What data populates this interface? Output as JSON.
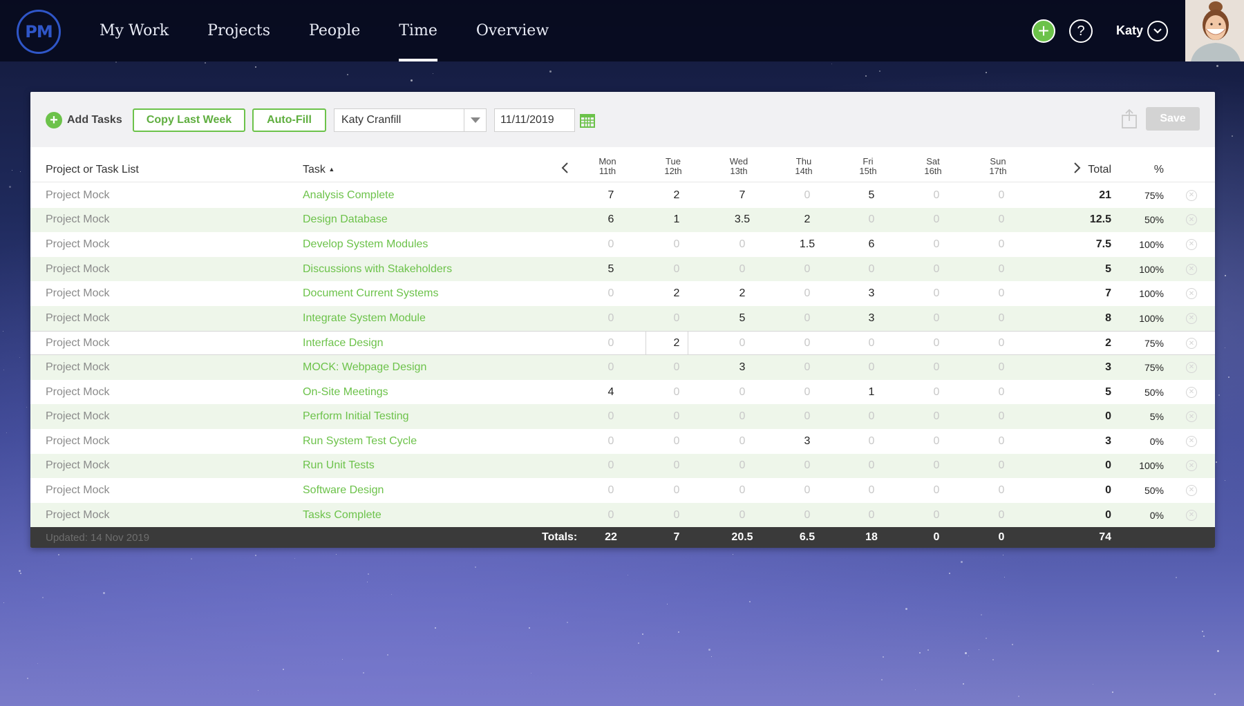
{
  "app": {
    "logo_text": "PM"
  },
  "nav": {
    "items": [
      {
        "label": "My Work"
      },
      {
        "label": "Projects"
      },
      {
        "label": "People"
      },
      {
        "label": "Time",
        "active": true
      },
      {
        "label": "Overview"
      }
    ],
    "user_name": "Katy",
    "add_icon": "plus-circle-icon",
    "help_icon": "question-circle-icon"
  },
  "toolbar": {
    "add_tasks_label": "Add Tasks",
    "copy_last_week_label": "Copy Last Week",
    "auto_fill_label": "Auto-Fill",
    "user_select_value": "Katy Cranfill",
    "date_value": "11/11/2019",
    "save_label": "Save"
  },
  "table": {
    "headers": {
      "project": "Project or Task List",
      "task": "Task",
      "task_sort": "▲",
      "total": "Total",
      "percent": "%"
    },
    "days": [
      {
        "day": "Mon",
        "date": "11th"
      },
      {
        "day": "Tue",
        "date": "12th"
      },
      {
        "day": "Wed",
        "date": "13th"
      },
      {
        "day": "Thu",
        "date": "14th"
      },
      {
        "day": "Fri",
        "date": "15th"
      },
      {
        "day": "Sat",
        "date": "16th"
      },
      {
        "day": "Sun",
        "date": "17th"
      }
    ],
    "rows": [
      {
        "project": "Project Mock",
        "task": "Analysis Complete",
        "hours": [
          "7",
          "2",
          "7",
          "0",
          "5",
          "0",
          "0"
        ],
        "total": "21",
        "pct": "75%"
      },
      {
        "project": "Project Mock",
        "task": "Design Database",
        "hours": [
          "6",
          "1",
          "3.5",
          "2",
          "0",
          "0",
          "0"
        ],
        "total": "12.5",
        "pct": "50%"
      },
      {
        "project": "Project Mock",
        "task": "Develop System Modules",
        "hours": [
          "0",
          "0",
          "0",
          "1.5",
          "6",
          "0",
          "0"
        ],
        "total": "7.5",
        "pct": "100%"
      },
      {
        "project": "Project Mock",
        "task": "Discussions with Stakeholders",
        "hours": [
          "5",
          "0",
          "0",
          "0",
          "0",
          "0",
          "0"
        ],
        "total": "5",
        "pct": "100%"
      },
      {
        "project": "Project Mock",
        "task": "Document Current Systems",
        "hours": [
          "0",
          "2",
          "2",
          "0",
          "3",
          "0",
          "0"
        ],
        "total": "7",
        "pct": "100%"
      },
      {
        "project": "Project Mock",
        "task": "Integrate System Module",
        "hours": [
          "0",
          "0",
          "5",
          "0",
          "3",
          "0",
          "0"
        ],
        "total": "8",
        "pct": "100%"
      },
      {
        "project": "Project Mock",
        "task": "Interface Design",
        "hours": [
          "0",
          "2",
          "0",
          "0",
          "0",
          "0",
          "0"
        ],
        "total": "2",
        "pct": "75%",
        "editing": true
      },
      {
        "project": "Project Mock",
        "task": "MOCK: Webpage Design",
        "hours": [
          "0",
          "0",
          "3",
          "0",
          "0",
          "0",
          "0"
        ],
        "total": "3",
        "pct": "75%"
      },
      {
        "project": "Project Mock",
        "task": "On-Site Meetings",
        "hours": [
          "4",
          "0",
          "0",
          "0",
          "1",
          "0",
          "0"
        ],
        "total": "5",
        "pct": "50%"
      },
      {
        "project": "Project Mock",
        "task": "Perform Initial Testing",
        "hours": [
          "0",
          "0",
          "0",
          "0",
          "0",
          "0",
          "0"
        ],
        "total": "0",
        "pct": "5%"
      },
      {
        "project": "Project Mock",
        "task": "Run System Test Cycle",
        "hours": [
          "0",
          "0",
          "0",
          "3",
          "0",
          "0",
          "0"
        ],
        "total": "3",
        "pct": "0%"
      },
      {
        "project": "Project Mock",
        "task": "Run Unit Tests",
        "hours": [
          "0",
          "0",
          "0",
          "0",
          "0",
          "0",
          "0"
        ],
        "total": "0",
        "pct": "100%"
      },
      {
        "project": "Project Mock",
        "task": "Software Design",
        "hours": [
          "0",
          "0",
          "0",
          "0",
          "0",
          "0",
          "0"
        ],
        "total": "0",
        "pct": "50%"
      },
      {
        "project": "Project Mock",
        "task": "Tasks Complete",
        "hours": [
          "0",
          "0",
          "0",
          "0",
          "0",
          "0",
          "0"
        ],
        "total": "0",
        "pct": "0%"
      }
    ],
    "footer": {
      "updated": "Updated: 14 Nov 2019",
      "totals_label": "Totals:",
      "day_totals": [
        "22",
        "7",
        "20.5",
        "6.5",
        "18",
        "0",
        "0"
      ],
      "grand_total": "74"
    }
  }
}
